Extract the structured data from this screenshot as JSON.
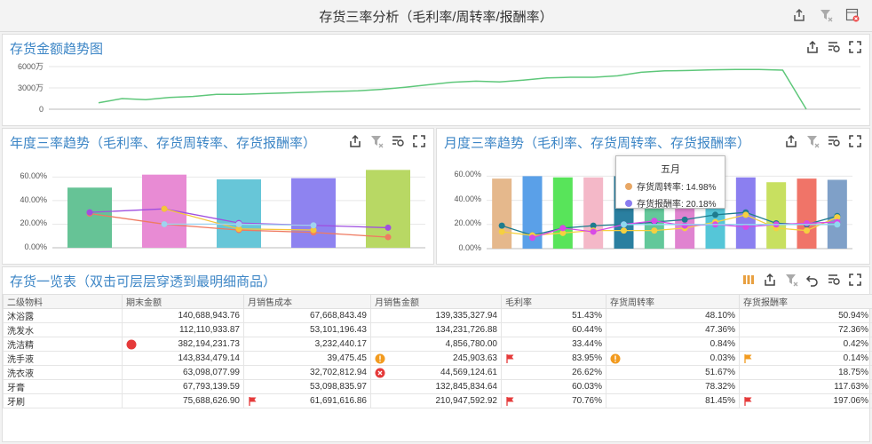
{
  "header": {
    "title": "存货三率分析（毛利率/周转率/报酬率）",
    "icons": [
      "export-icon",
      "filter-clear-icon",
      "close-filter-icon"
    ]
  },
  "trend_panel": {
    "title": "存货金额趋势图",
    "icons": [
      "export-icon",
      "filter-mode-icon",
      "fullscreen-icon"
    ],
    "y_ticks": [
      "6000万",
      "3000万",
      "0"
    ]
  },
  "year_panel": {
    "title": "年度三率趋势（毛利率、存货周转率、存货报酬率）",
    "icons": [
      "export-icon",
      "filter-clear-icon",
      "filter-mode-icon",
      "fullscreen-icon"
    ],
    "y_ticks": [
      "60.00%",
      "40.00%",
      "20.00%",
      "0.00%"
    ]
  },
  "month_panel": {
    "title": "月度三率趋势（毛利率、存货周转率、存货报酬率）",
    "icons": [
      "export-icon",
      "filter-clear-icon",
      "filter-mode-icon",
      "fullscreen-icon"
    ],
    "y_ticks": [
      "60.00%",
      "40.00%",
      "20.00%",
      "0.00%"
    ],
    "tooltip": {
      "title": "五月",
      "rows": [
        {
          "label": "存货周转率: 14.98%",
          "color": "#e8a765"
        },
        {
          "label": "存货报酬率: 20.18%",
          "color": "#8a7cf0"
        }
      ]
    }
  },
  "chart_data": [
    {
      "type": "line",
      "title": "存货金额趋势图",
      "ylim": [
        0,
        70000000
      ],
      "series": [
        {
          "values": [
            9000000,
            15000000,
            13500000,
            16500000,
            18000000,
            21000000,
            21000000,
            22000000,
            23000000,
            24000000,
            25000000,
            26000000,
            28000000,
            31000000,
            34500000,
            38000000,
            39500000,
            38500000,
            41000000,
            44000000,
            45000000,
            45000000,
            47000000,
            52000000,
            54000000,
            54500000,
            55500000,
            56000000,
            56000000,
            55000000,
            0
          ]
        }
      ]
    },
    {
      "type": "bar",
      "title": "年度三率趋势（毛利率、存货周转率、存货报酬率）",
      "ylim": [
        0,
        70
      ],
      "bar_values": [
        51,
        62,
        58,
        59,
        66
      ],
      "bar_colors": [
        "#66c396",
        "#e88bd4",
        "#67c6d8",
        "#8e83f0",
        "#b8d864"
      ],
      "series": [
        {
          "color": "#ef7b62",
          "values": [
            29,
            20,
            15,
            13,
            9
          ]
        },
        {
          "color": "#9f4fe0",
          "values": [
            30,
            33,
            21,
            19,
            17
          ]
        },
        {
          "color": "#f5c53b",
          "values": [
            null,
            33,
            16,
            15,
            null
          ]
        },
        {
          "color": "#9fd3f0",
          "values": [
            null,
            20,
            20,
            19,
            null
          ]
        }
      ]
    },
    {
      "type": "bar",
      "title": "月度三率趋势（毛利率、存货周转率、存货报酬率）",
      "ylim": [
        0,
        65
      ],
      "bar_values": [
        58,
        60,
        59,
        59,
        60,
        59,
        59,
        60,
        59,
        55,
        58,
        57
      ],
      "bar_colors": [
        "#e5b88c",
        "#5aa0e8",
        "#58e45a",
        "#f4b8c8",
        "#2a7fa0",
        "#63c89a",
        "#e083d0",
        "#55c6d8",
        "#8b7ff0",
        "#c8e060",
        "#f07468",
        "#7fa0c8"
      ],
      "series": [
        {
          "color": "#1e7c8e",
          "values": [
            19,
            11,
            17,
            19,
            20,
            22,
            24,
            28,
            30,
            21,
            20,
            27
          ]
        },
        {
          "color": "#f5d040",
          "values": [
            14,
            11,
            13,
            15,
            15,
            15,
            17,
            22,
            28,
            17,
            15,
            26
          ]
        },
        {
          "color": "#d84ae6",
          "values": [
            null,
            9,
            17,
            14,
            20,
            23,
            19,
            20,
            18,
            20,
            21,
            22
          ]
        },
        {
          "color": "#8fd8f0",
          "values": [
            null,
            null,
            null,
            null,
            20,
            null,
            null,
            null,
            null,
            null,
            null,
            20
          ]
        }
      ]
    }
  ],
  "table_panel": {
    "title": "存货一览表（双击可层层穿透到最明细商品）",
    "icons": [
      "grid-icon",
      "export-icon",
      "filter-clear-icon",
      "undo-icon",
      "filter-mode-icon",
      "fullscreen-icon"
    ],
    "columns": [
      "二级物料",
      "期末金额",
      "月销售成本",
      "月销售金额",
      "毛利率",
      "存货周转率",
      "存货报酬率"
    ],
    "rows": [
      {
        "cells": [
          "沐浴露",
          "140,688,943.76",
          "67,668,843.49",
          "139,335,327.94",
          "51.43%",
          "48.10%",
          "50.94%"
        ],
        "marks": [
          null,
          null,
          null,
          null,
          null,
          null,
          null
        ]
      },
      {
        "cells": [
          "洗发水",
          "112,110,933.87",
          "53,101,196.43",
          "134,231,726.88",
          "60.44%",
          "47.36%",
          "72.36%"
        ],
        "marks": [
          null,
          null,
          null,
          null,
          null,
          null,
          null
        ]
      },
      {
        "cells": [
          "洗洁精",
          "382,194,231.73",
          "3,232,440.17",
          "4,856,780.00",
          "33.44%",
          "0.84%",
          "0.42%"
        ],
        "marks": [
          null,
          "red-dot",
          null,
          null,
          null,
          null,
          null
        ]
      },
      {
        "cells": [
          "洗手液",
          "143,834,479.14",
          "39,475.45",
          "245,903.63",
          "83.95%",
          "0.03%",
          "0.14%"
        ],
        "marks": [
          null,
          null,
          null,
          "warn",
          "red-flag",
          "warn",
          "orange-flag"
        ]
      },
      {
        "cells": [
          "洗衣液",
          "63,098,077.99",
          "32,702,812.94",
          "44,569,124.61",
          "26.62%",
          "51.67%",
          "18.75%"
        ],
        "marks": [
          null,
          null,
          null,
          "x-circle",
          null,
          null,
          null
        ]
      },
      {
        "cells": [
          "牙膏",
          "67,793,139.59",
          "53,098,835.97",
          "132,845,834.64",
          "60.03%",
          "78.32%",
          "117.63%"
        ],
        "marks": [
          null,
          null,
          null,
          null,
          null,
          null,
          null
        ]
      },
      {
        "cells": [
          "牙刷",
          "75,688,626.90",
          "61,691,616.86",
          "210,947,592.92",
          "70.76%",
          "81.45%",
          "197.06%"
        ],
        "marks": [
          null,
          null,
          "red-flag",
          null,
          "red-flag",
          null,
          "red-flag"
        ]
      }
    ]
  }
}
